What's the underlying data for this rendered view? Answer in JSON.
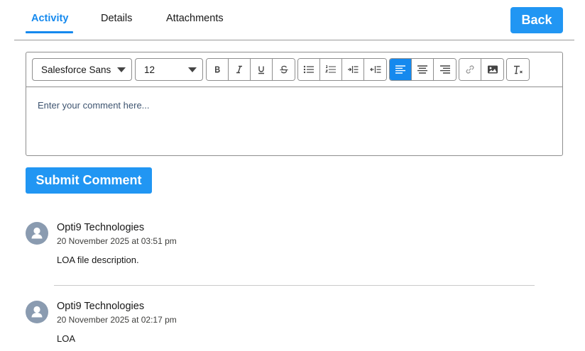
{
  "tabs": [
    {
      "label": "Activity",
      "active": true
    },
    {
      "label": "Details",
      "active": false
    },
    {
      "label": "Attachments",
      "active": false
    }
  ],
  "header": {
    "back_label": "Back"
  },
  "editor": {
    "font_family": "Salesforce Sans",
    "font_size": "12",
    "placeholder": "Enter your comment here...",
    "toolbar_icons": [
      "bold-icon",
      "italic-icon",
      "underline-icon",
      "strikethrough-icon",
      "bullet-list-icon",
      "numbered-list-icon",
      "indent-icon",
      "outdent-icon",
      "align-left-icon",
      "align-center-icon",
      "align-right-icon",
      "link-icon",
      "image-icon",
      "clear-formatting-icon"
    ],
    "active_alignment": "left"
  },
  "actions": {
    "submit_label": "Submit Comment"
  },
  "comments": [
    {
      "author": "Opti9 Technologies",
      "timestamp": "20 November 2025 at 03:51 pm",
      "body": "LOA file description."
    },
    {
      "author": "Opti9 Technologies",
      "timestamp": "20 November 2025 at 02:17 pm",
      "body": "LOA"
    }
  ],
  "colors": {
    "accent": "#2196f3",
    "tab_active": "#1589ee",
    "avatar": "#8a9bb0"
  }
}
